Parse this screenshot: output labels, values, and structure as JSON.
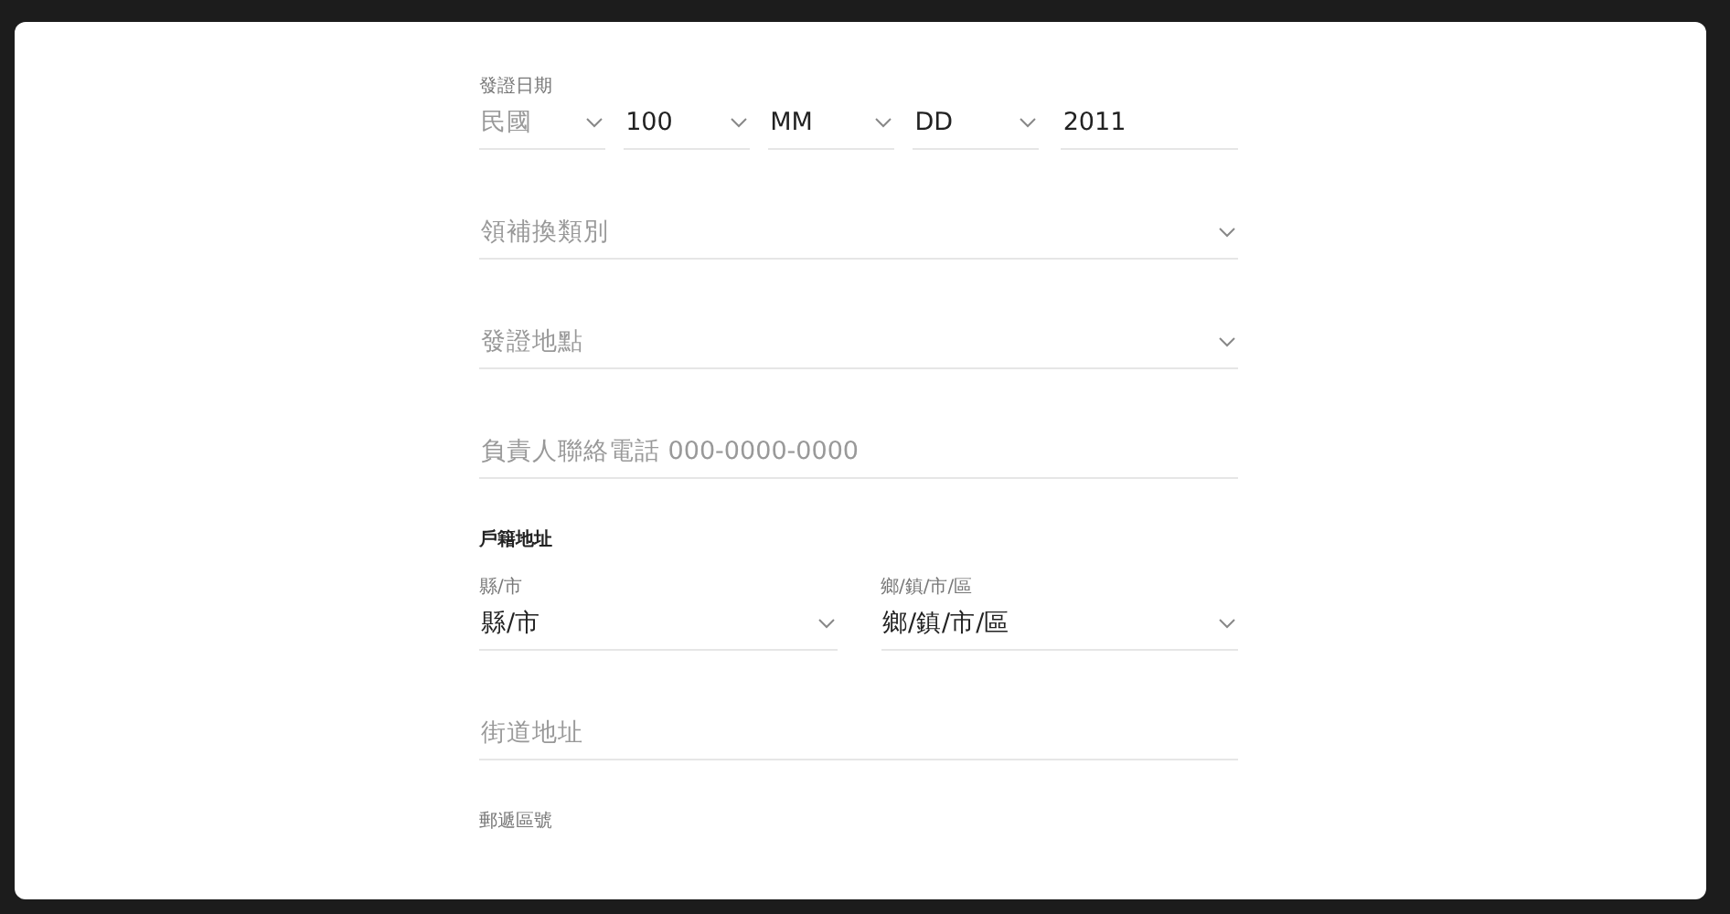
{
  "fields": [
    {
      "kind": "date",
      "label": "發證日期",
      "parts": [
        {
          "kind": "select",
          "placeholder": "民國"
        },
        {
          "kind": "select",
          "value": "100"
        },
        {
          "kind": "select",
          "value": "MM"
        },
        {
          "kind": "select",
          "value": "DD"
        },
        {
          "kind": "input",
          "value": "2011"
        }
      ]
    },
    {
      "kind": "select",
      "placeholder": "領補換類別"
    },
    {
      "kind": "select",
      "placeholder": "發證地點"
    },
    {
      "kind": "input",
      "placeholder": "負責人聯絡電話 000-0000-0000"
    },
    {
      "kind": "heading",
      "text": "戶籍地址"
    },
    {
      "kind": "pair",
      "parts": [
        {
          "kind": "select",
          "label": "縣/市",
          "value": "縣/市"
        },
        {
          "kind": "select",
          "label": "鄉/鎮/市/區",
          "value": "鄉/鎮/市/區"
        }
      ]
    },
    {
      "kind": "input",
      "placeholder": "街道地址"
    },
    {
      "kind": "label",
      "text": "郵遞區號"
    }
  ]
}
